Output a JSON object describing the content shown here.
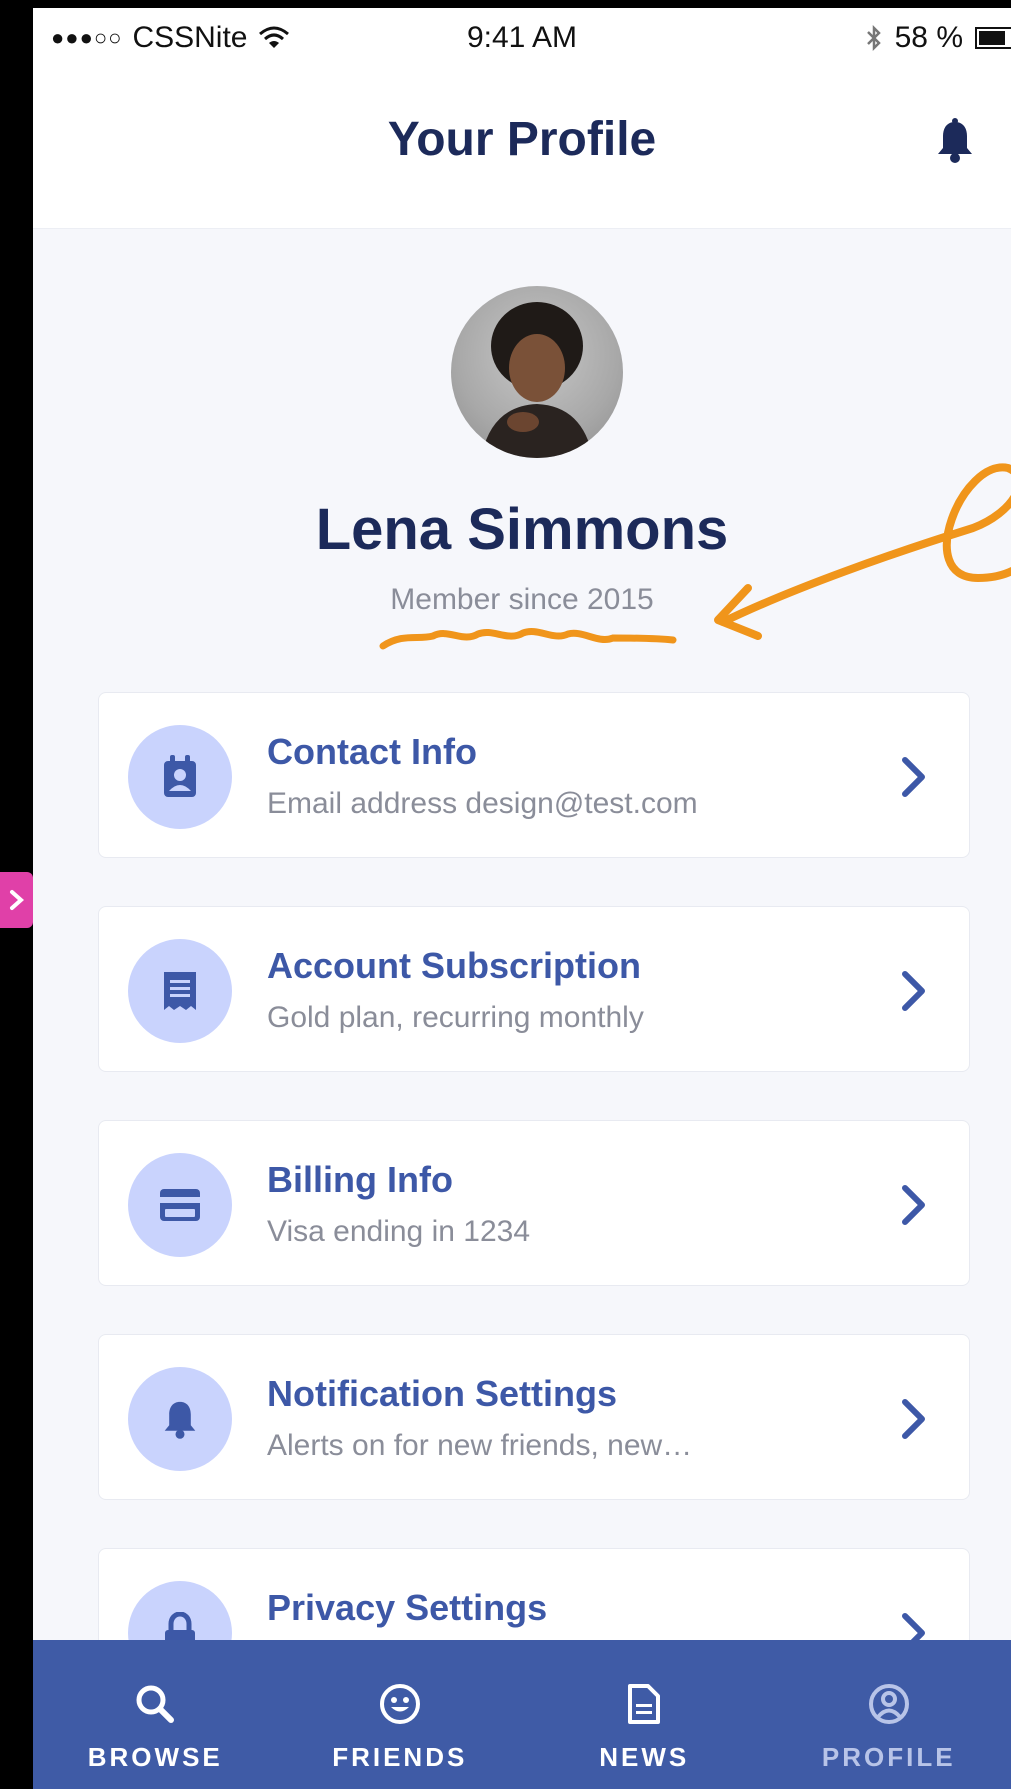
{
  "status_bar": {
    "signal": "●●●○○",
    "carrier": "CSSNite",
    "time": "9:41 AM",
    "bluetooth": "bluetooth-icon",
    "battery": "58 %",
    "battery_level": 0.58
  },
  "header": {
    "title": "Your Profile",
    "icon": "bell-icon"
  },
  "profile": {
    "name": "Lena Simmons",
    "member_since": "Member since 2015"
  },
  "menu": [
    {
      "title": "Contact Info",
      "subtitle": "Email address design@test.com",
      "icon": "contact-card-icon"
    },
    {
      "title": "Account Subscription",
      "subtitle": "Gold plan, recurring monthly",
      "icon": "receipt-icon"
    },
    {
      "title": "Billing Info",
      "subtitle": "Visa ending in 1234",
      "icon": "credit-card-icon"
    },
    {
      "title": "Notification Settings",
      "subtitle": "Alerts on for new friends, new…",
      "icon": "bell-icon"
    },
    {
      "title": "Privacy Settings",
      "subtitle": "",
      "icon": "lock-icon"
    }
  ],
  "tabs": [
    {
      "label": "BROWSE",
      "icon": "search-icon"
    },
    {
      "label": "FRIENDS",
      "icon": "smiley-icon"
    },
    {
      "label": "NEWS",
      "icon": "document-icon"
    },
    {
      "label": "PROFILE",
      "icon": "user-circle-icon"
    }
  ],
  "colors": {
    "primary": "#3f5ba6",
    "title": "#1c2a5a",
    "icon_bg": "#c9d3fd",
    "annotation": "#f0951b"
  }
}
